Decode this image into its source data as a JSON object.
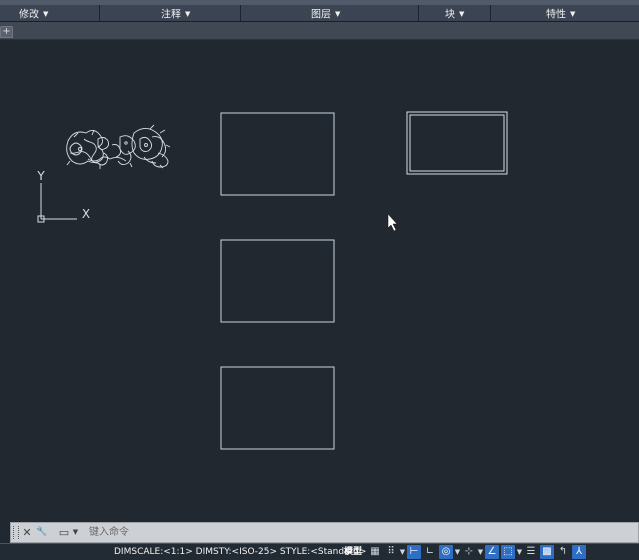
{
  "ribbon": {
    "panels": [
      {
        "label": "修改",
        "caret": "▼"
      },
      {
        "label": "注释",
        "caret": "▼"
      },
      {
        "label": "图层",
        "caret": "▼"
      },
      {
        "label": "块",
        "caret": "▼"
      },
      {
        "label": "特性",
        "caret": "▼"
      }
    ],
    "new_tab_glyph": "+"
  },
  "drawing": {
    "ucs": {
      "x_label": "X",
      "y_label": "Y"
    },
    "background_color": "#212830",
    "line_color": "#c8d6e8"
  },
  "command_line": {
    "close_glyph": "✕",
    "settings_glyph": "🔧",
    "prompt_glyph": "▭",
    "placeholder": "键入命令"
  },
  "status_bar": {
    "text": "DIMSCALE:<1:1> DIMSTY:<ISO-25> STYLE:<Standard>",
    "model_label": "模型",
    "icons": [
      {
        "name": "grid-icon",
        "glyph": "▦",
        "on": false
      },
      {
        "name": "snap-icon",
        "glyph": "⠿",
        "on": false
      },
      {
        "name": "infer-icon",
        "glyph": "⊢",
        "on": true
      },
      {
        "name": "ortho-icon",
        "glyph": "∟",
        "on": false
      },
      {
        "name": "polar-icon",
        "glyph": "◎",
        "on": true
      },
      {
        "name": "osnap-icon",
        "glyph": "⊹",
        "on": false
      },
      {
        "name": "otrack-icon",
        "glyph": "∠",
        "on": true
      },
      {
        "name": "ducs-icon",
        "glyph": "⬚",
        "on": true
      },
      {
        "name": "lineweight-icon",
        "glyph": "☰",
        "on": false
      },
      {
        "name": "transparency-icon",
        "glyph": "▩",
        "on": true
      },
      {
        "name": "selection-cycling-icon",
        "glyph": "↰",
        "on": false
      },
      {
        "name": "annotation-scale-icon",
        "glyph": "⅄",
        "on": true
      }
    ]
  },
  "colors": {
    "ribbon": "#3b4452",
    "accent": "#2e6fc4"
  }
}
